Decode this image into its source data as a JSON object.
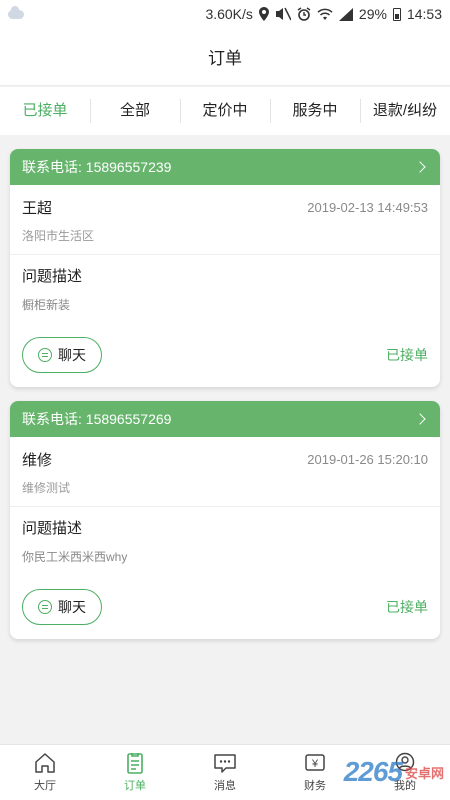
{
  "statusbar": {
    "speed": "3.60K/s",
    "battery": "29%",
    "time": "14:53"
  },
  "header": {
    "title": "订单"
  },
  "tabs": [
    {
      "label": "已接单",
      "active": true
    },
    {
      "label": "全部"
    },
    {
      "label": "定价中"
    },
    {
      "label": "服务中"
    },
    {
      "label": "退款/纠纷"
    }
  ],
  "orders": [
    {
      "phone_label": "联系电话: 15896557239",
      "customer": "王超",
      "time": "2019-02-13 14:49:53",
      "address": "洛阳市生活区",
      "desc_title": "问题描述",
      "desc": "橱柜新装",
      "chat_label": "聊天",
      "status": "已接单"
    },
    {
      "phone_label": "联系电话: 15896557269",
      "customer": "维修",
      "time": "2019-01-26 15:20:10",
      "address": "维修测试",
      "desc_title": "问题描述",
      "desc": "你民工米西米西why",
      "chat_label": "聊天",
      "status": "已接单"
    }
  ],
  "bottom_nav": [
    {
      "label": "大厅",
      "icon": "home-icon"
    },
    {
      "label": "订单",
      "icon": "order-icon",
      "active": true
    },
    {
      "label": "消息",
      "icon": "message-icon"
    },
    {
      "label": "财务",
      "icon": "finance-icon"
    },
    {
      "label": "我的",
      "icon": "profile-icon"
    }
  ],
  "watermark": {
    "logo": "2265",
    "text": "安卓网"
  },
  "colors": {
    "accent": "#4caf63",
    "card_header": "#67b56d"
  }
}
